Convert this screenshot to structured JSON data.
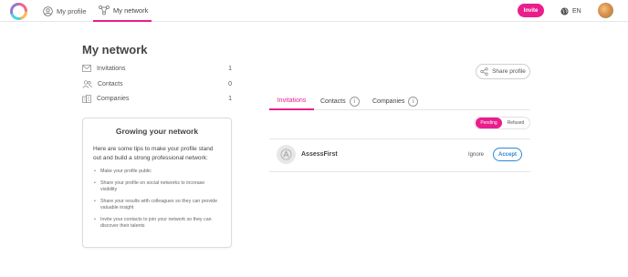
{
  "header": {
    "nav": [
      {
        "label": "My profile",
        "icon": "user-circle-icon"
      },
      {
        "label": "My network",
        "icon": "network-icon"
      }
    ],
    "invite_label": "Invite",
    "language": "EN",
    "accent_color": "#e91e8c"
  },
  "sidebar": {
    "title": "My network",
    "summary": [
      {
        "label": "Invitations",
        "count": "1",
        "icon": "envelope-icon"
      },
      {
        "label": "Contacts",
        "count": "0",
        "icon": "people-icon"
      },
      {
        "label": "Companies",
        "count": "1",
        "icon": "building-icon"
      }
    ],
    "tips": {
      "title": "Growing your network",
      "intro": "Here are some tips to make your profile stand out and build a strong professional network:",
      "items": [
        "Make your profile public",
        "Share your profile on social networks to increase visibility",
        "Share your results with colleagues so they can provide valuable insight",
        "Invite your contacts to join your network so they can discover their talents"
      ]
    }
  },
  "main": {
    "share_label": "Share profile",
    "tabs": [
      {
        "label": "Invitations",
        "badge": ""
      },
      {
        "label": "Contacts",
        "badge": "i"
      },
      {
        "label": "Companies",
        "badge": "i"
      }
    ],
    "filters": {
      "pending": "Pending",
      "refused": "Refused",
      "selected": "Pending"
    },
    "invitation": {
      "company": "AssessFirst",
      "ignore_label": "Ignore",
      "accept_label": "Accept"
    },
    "link_color": "#2b89d6"
  }
}
